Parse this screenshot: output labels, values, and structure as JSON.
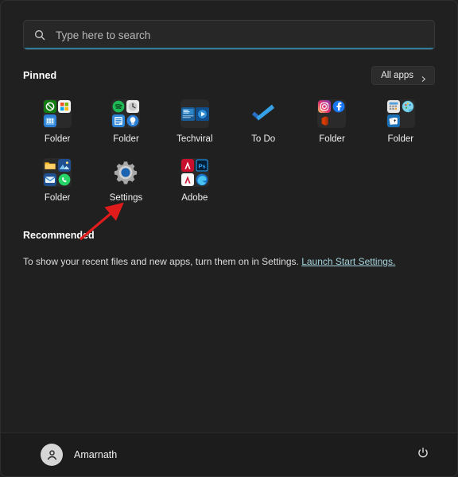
{
  "window": {
    "title": "Start",
    "background": "#202020"
  },
  "search": {
    "placeholder": "Type here to search",
    "value": "",
    "icon": "search-icon",
    "underline_color": "#2d7d9a"
  },
  "pinned": {
    "title": "Pinned",
    "all_apps": {
      "label": "All apps",
      "icon": "chevron-right-icon"
    },
    "items": [
      {
        "label": "Folder",
        "kind": "folder",
        "apps": [
          "xbox-icon",
          "microsoft-store-icon",
          "calendar-icon"
        ]
      },
      {
        "label": "Folder",
        "kind": "folder",
        "apps": [
          "spotify-icon",
          "clock-icon",
          "notes-icon",
          "tips-icon"
        ]
      },
      {
        "label": "Techviral",
        "kind": "folder-wide",
        "apps": [
          "news-icon",
          "media-player-icon"
        ]
      },
      {
        "label": "To Do",
        "kind": "app",
        "apps": [
          "to-do-icon"
        ]
      },
      {
        "label": "Folder",
        "kind": "folder",
        "apps": [
          "instagram-icon",
          "facebook-icon",
          "office-icon"
        ]
      },
      {
        "label": "Folder",
        "kind": "folder",
        "apps": [
          "calculator-icon",
          "paint-icon",
          "solitaire-icon"
        ]
      },
      {
        "label": "Folder",
        "kind": "folder",
        "apps": [
          "file-explorer-icon",
          "photos-icon",
          "mail-icon",
          "whatsapp-icon"
        ]
      },
      {
        "label": "Settings",
        "kind": "app",
        "apps": [
          "settings-gear-icon"
        ]
      },
      {
        "label": "Adobe",
        "kind": "folder",
        "apps": [
          "acrobat-icon",
          "photoshop-icon",
          "acrobat-reader-icon",
          "edge-icon"
        ]
      }
    ]
  },
  "annotation": {
    "type": "arrow",
    "color": "#e01b1b",
    "points_to": "Settings"
  },
  "recommended": {
    "title": "Recommended",
    "empty_text": "To show your recent files and new apps, turn them on in Settings. ",
    "link_label": "Launch Start Settings.",
    "link_color": "#a6d4de"
  },
  "bottom": {
    "user_name": "Amarnath",
    "avatar_icon": "user-avatar-icon",
    "power_icon": "power-icon"
  }
}
